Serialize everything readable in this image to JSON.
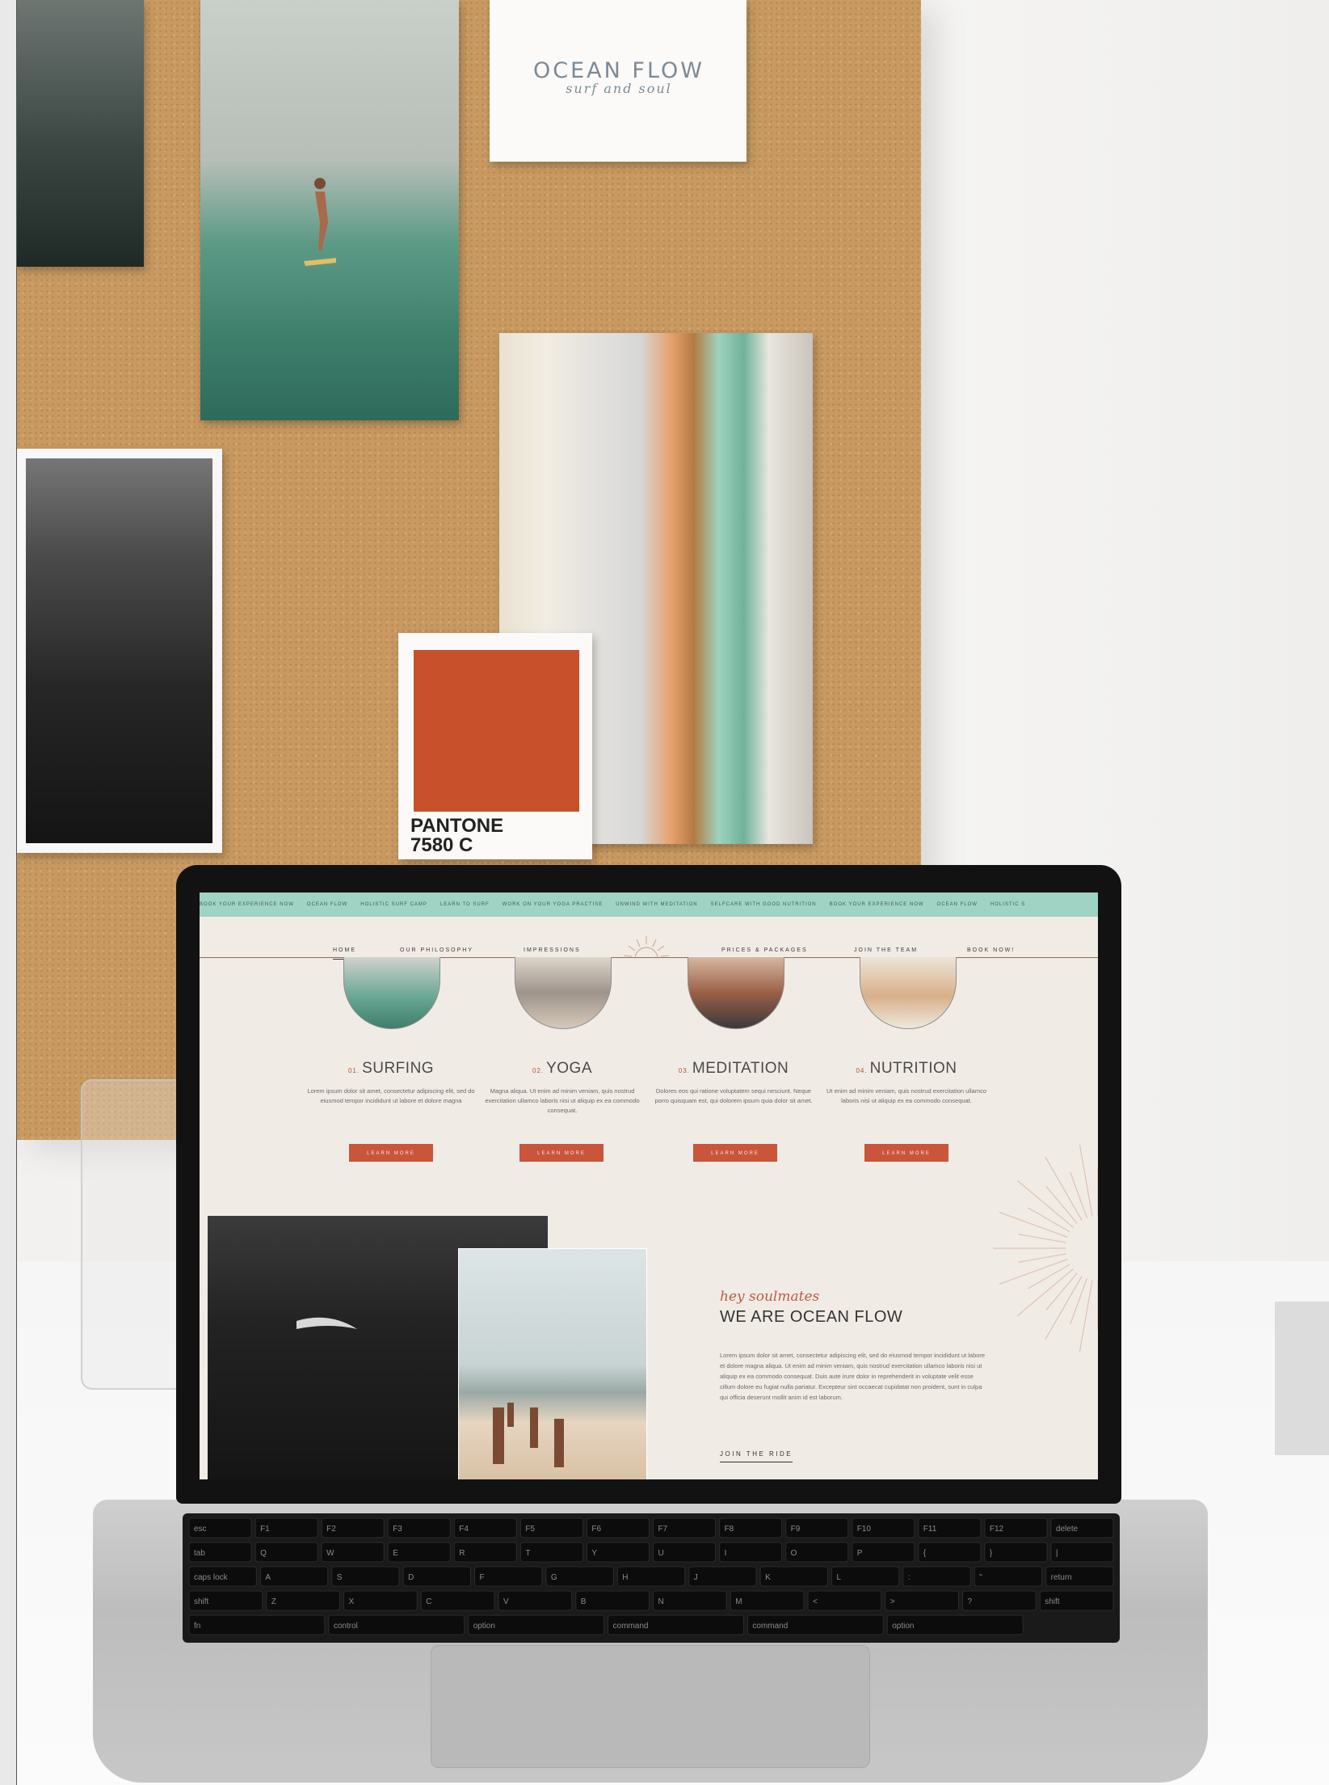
{
  "scene": {
    "logo_card": {
      "title": "OCEAN FLOW",
      "subtitle": "surf and soul"
    },
    "pantone": {
      "brand": "PANTONE",
      "code": "7580 C",
      "swatch_color": "#c8502b"
    }
  },
  "website": {
    "ticker": [
      "BOOK YOUR EXPERIENCE NOW",
      "OCEAN FLOW",
      "HOLISTIC SURF CAMP",
      "LEARN TO SURF",
      "WORK ON YOUR YOGA PRACTISE",
      "UNWIND WITH MEDITATION",
      "SELFCARE WITH GOOD NUTRITION",
      "BOOK YOUR EXPERIENCE NOW",
      "OCEAN FLOW",
      "HOLISTIC S"
    ],
    "nav": {
      "home": "HOME",
      "philosophy": "OUR PHILOSOPHY",
      "impressions": "IMPRESSIONS",
      "prices": "PRICES & PACKAGES",
      "team": "JOIN THE TEAM",
      "book": "BOOK NOW!"
    },
    "services": [
      {
        "num": "01.",
        "title": "SURFING",
        "desc": "Lorem ipsum dolor sit amet, consectetur adipiscing elit, sed do eiusmod tempor incididunt ut labore et dolore magna",
        "button": "LEARN MORE"
      },
      {
        "num": "02.",
        "title": "YOGA",
        "desc": "Magna aliqua. Ut enim ad minim veniam, quis nostrud exercitation ullamco laboris nisi ut aliquip ex ea commodo consequat.",
        "button": "LEARN MORE"
      },
      {
        "num": "03.",
        "title": "MEDITATION",
        "desc": "Dolores eos qui ratione voluptatem sequi nesciunt. Neque porro quisquam est, qui dolorem ipsum quia dolor sit amet.",
        "button": "LEARN MORE"
      },
      {
        "num": "04.",
        "title": "NUTRITION",
        "desc": "Ut enim ad minim veniam, quis nostrud exercitation ullamco laboris nisi ut aliquip ex ea commodo consequat.",
        "button": "LEARN MORE"
      }
    ],
    "about": {
      "script": "hey soulmates",
      "title": "WE ARE OCEAN FLOW",
      "body": "Lorem ipsum dolor sit amet, consectetur adipiscing elit, sed do eiusmod tempor incididunt ut labore et dolore magna aliqua. Ut enim ad minim veniam, quis nostrud exercitation ullamco laboris nisi ut aliquip ex ea commodo consequat. Duis aute irure dolor in reprehenderit in voluptate velit esse cillum dolore eu fugiat nulla pariatur. Excepteur sint occaecat cupidatat non proident, sunt in culpa qui officia deserunt mollit anim id est laborum.",
      "link": "JOIN THE RIDE"
    },
    "colors": {
      "accent": "#c9553b",
      "ticker": "#9fd3c4",
      "background": "#f1ebe5"
    }
  },
  "keyboard": {
    "row1": [
      "esc",
      "F1",
      "F2",
      "F3",
      "F4",
      "F5",
      "F6",
      "F7",
      "F8",
      "F9",
      "F10",
      "F11",
      "F12",
      "delete"
    ],
    "row2": [
      "tab",
      "Q",
      "W",
      "E",
      "R",
      "T",
      "Y",
      "U",
      "I",
      "O",
      "P",
      "{",
      "}",
      "|"
    ],
    "row3": [
      "caps lock",
      "A",
      "S",
      "D",
      "F",
      "G",
      "H",
      "J",
      "K",
      "L",
      ":",
      "\"",
      "return"
    ],
    "row4": [
      "shift",
      "Z",
      "X",
      "C",
      "V",
      "B",
      "N",
      "M",
      "<",
      ">",
      "?",
      "shift"
    ],
    "row5": [
      "fn",
      "control",
      "option",
      "command",
      "command",
      "option"
    ]
  }
}
